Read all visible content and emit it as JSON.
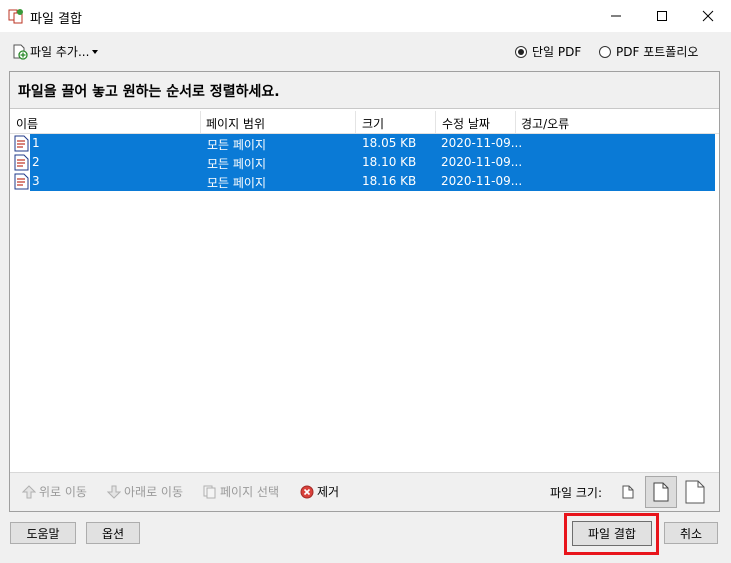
{
  "window": {
    "title": "파일 결합",
    "minimize_icon": "minimize-icon",
    "maximize_icon": "maximize-icon",
    "close_icon": "close-icon"
  },
  "toolbar": {
    "add_files_label": "파일 추가...",
    "add_files_icon": "add-file-icon",
    "dropdown_icon": "caret-down-icon",
    "mode_options": [
      {
        "label": "단일 PDF",
        "selected": true
      },
      {
        "label": "PDF 포트폴리오",
        "selected": false
      }
    ]
  },
  "instruction": "파일을 끌어 놓고 원하는 순서로 정렬하세요.",
  "table": {
    "columns": [
      "이름",
      "페이지 범위",
      "크기",
      "수정 날짜",
      "경고/오류"
    ],
    "rows": [
      {
        "name": "1",
        "range": "모든 페이지",
        "size": "18.05 KB",
        "date": "2020-11-09...",
        "warning": ""
      },
      {
        "name": "2",
        "range": "모든 페이지",
        "size": "18.10 KB",
        "date": "2020-11-09...",
        "warning": ""
      },
      {
        "name": "3",
        "range": "모든 페이지",
        "size": "18.16 KB",
        "date": "2020-11-09...",
        "warning": ""
      }
    ],
    "selection_color": "#0a7ad6"
  },
  "actions": {
    "move_up": "위로 이동",
    "move_down": "아래로 이동",
    "select_pages": "페이지 선택",
    "remove": "제거",
    "file_size_label": "파일 크기:",
    "file_size_selected": "medium"
  },
  "footer": {
    "help": "도움말",
    "options": "옵션",
    "combine": "파일 결합",
    "cancel": "취소",
    "highlight_color": "#e8141b"
  }
}
